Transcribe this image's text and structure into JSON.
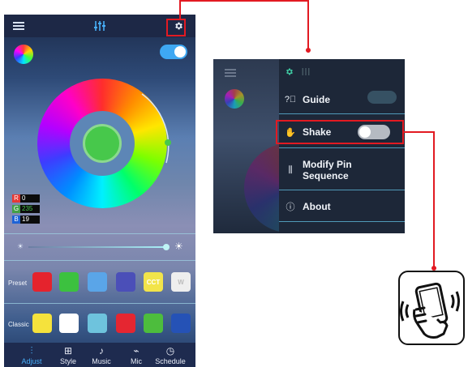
{
  "phone": {
    "color": {
      "r_label": "R",
      "r_value": "0",
      "g_label": "G",
      "g_value": "235",
      "b_label": "B",
      "b_value": "19",
      "r_tag_color": "#e53935",
      "g_tag_color": "#43a047",
      "b_tag_color": "#1e63d6",
      "selected_color": "#47c84b"
    },
    "brightness_fraction": 0.95,
    "power_toggle": "on",
    "preset_label": "Preset",
    "preset_swatches": [
      {
        "color": "#e5232d",
        "text": ""
      },
      {
        "color": "#3cc13f",
        "text": ""
      },
      {
        "color": "#5aa5e8",
        "text": ""
      },
      {
        "color": "#4b4fb8",
        "text": ""
      },
      {
        "color": "#f2e44a",
        "text": "CCT"
      },
      {
        "color": "#eeeeee",
        "text": "W"
      }
    ],
    "classic_label": "Classic",
    "classic_swatches": [
      {
        "color": "#f5e23c"
      },
      {
        "color": "#ffffff"
      },
      {
        "color": "#6ec3dd"
      },
      {
        "color": "#e52631"
      },
      {
        "color": "#4dbd3d"
      },
      {
        "color": "#2552b6"
      }
    ],
    "nav": [
      {
        "label": "Adjust",
        "icon": "sliders-icon"
      },
      {
        "label": "Style",
        "icon": "grid-icon"
      },
      {
        "label": "Music",
        "icon": "music-icon"
      },
      {
        "label": "Mic",
        "icon": "mic-icon"
      },
      {
        "label": "Schedule",
        "icon": "clock-icon"
      }
    ]
  },
  "menu": {
    "items": [
      {
        "label": "Guide",
        "icon": "question-icon"
      },
      {
        "label": "Shake",
        "icon": "shake-icon",
        "toggle": "off"
      },
      {
        "label": "Modify Pin Sequence",
        "label_line1": "Modify Pin",
        "label_line2": "Sequence",
        "icon": "pin-icon"
      },
      {
        "label": "About",
        "icon": "info-icon"
      }
    ]
  },
  "colors": {
    "highlight": "#e21a22",
    "accent": "#47aef8",
    "topbar": "#1d2846"
  }
}
